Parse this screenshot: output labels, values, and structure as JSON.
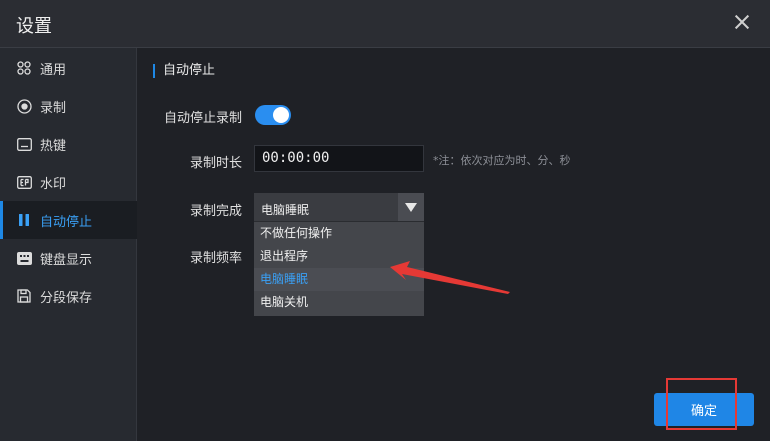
{
  "window": {
    "title": "设置"
  },
  "sidebar": {
    "items": [
      {
        "label": "通用",
        "icon": "grid-icon"
      },
      {
        "label": "录制",
        "icon": "record-icon"
      },
      {
        "label": "热键",
        "icon": "keyboard-icon"
      },
      {
        "label": "水印",
        "icon": "watermark-icon"
      },
      {
        "label": "自动停止",
        "icon": "auto-stop-icon",
        "active": true
      },
      {
        "label": "键盘显示",
        "icon": "keyboard-display-icon"
      },
      {
        "label": "分段保存",
        "icon": "save-icon"
      }
    ]
  },
  "main": {
    "section_title": "自动停止",
    "auto_stop": {
      "label": "自动停止录制",
      "enabled": true
    },
    "duration": {
      "label": "录制时长",
      "value": "00:00:00",
      "hint": "*注：依次对应为时、分、秒"
    },
    "completion": {
      "label": "录制完成",
      "selected": "电脑睡眠",
      "options": [
        "不做任何操作",
        "退出程序",
        "电脑睡眠",
        "电脑关机"
      ]
    },
    "frequency": {
      "label": "录制频率"
    }
  },
  "footer": {
    "confirm_label": "确定"
  },
  "colors": {
    "accent": "#1e88e5",
    "annotation": "#e53935"
  }
}
